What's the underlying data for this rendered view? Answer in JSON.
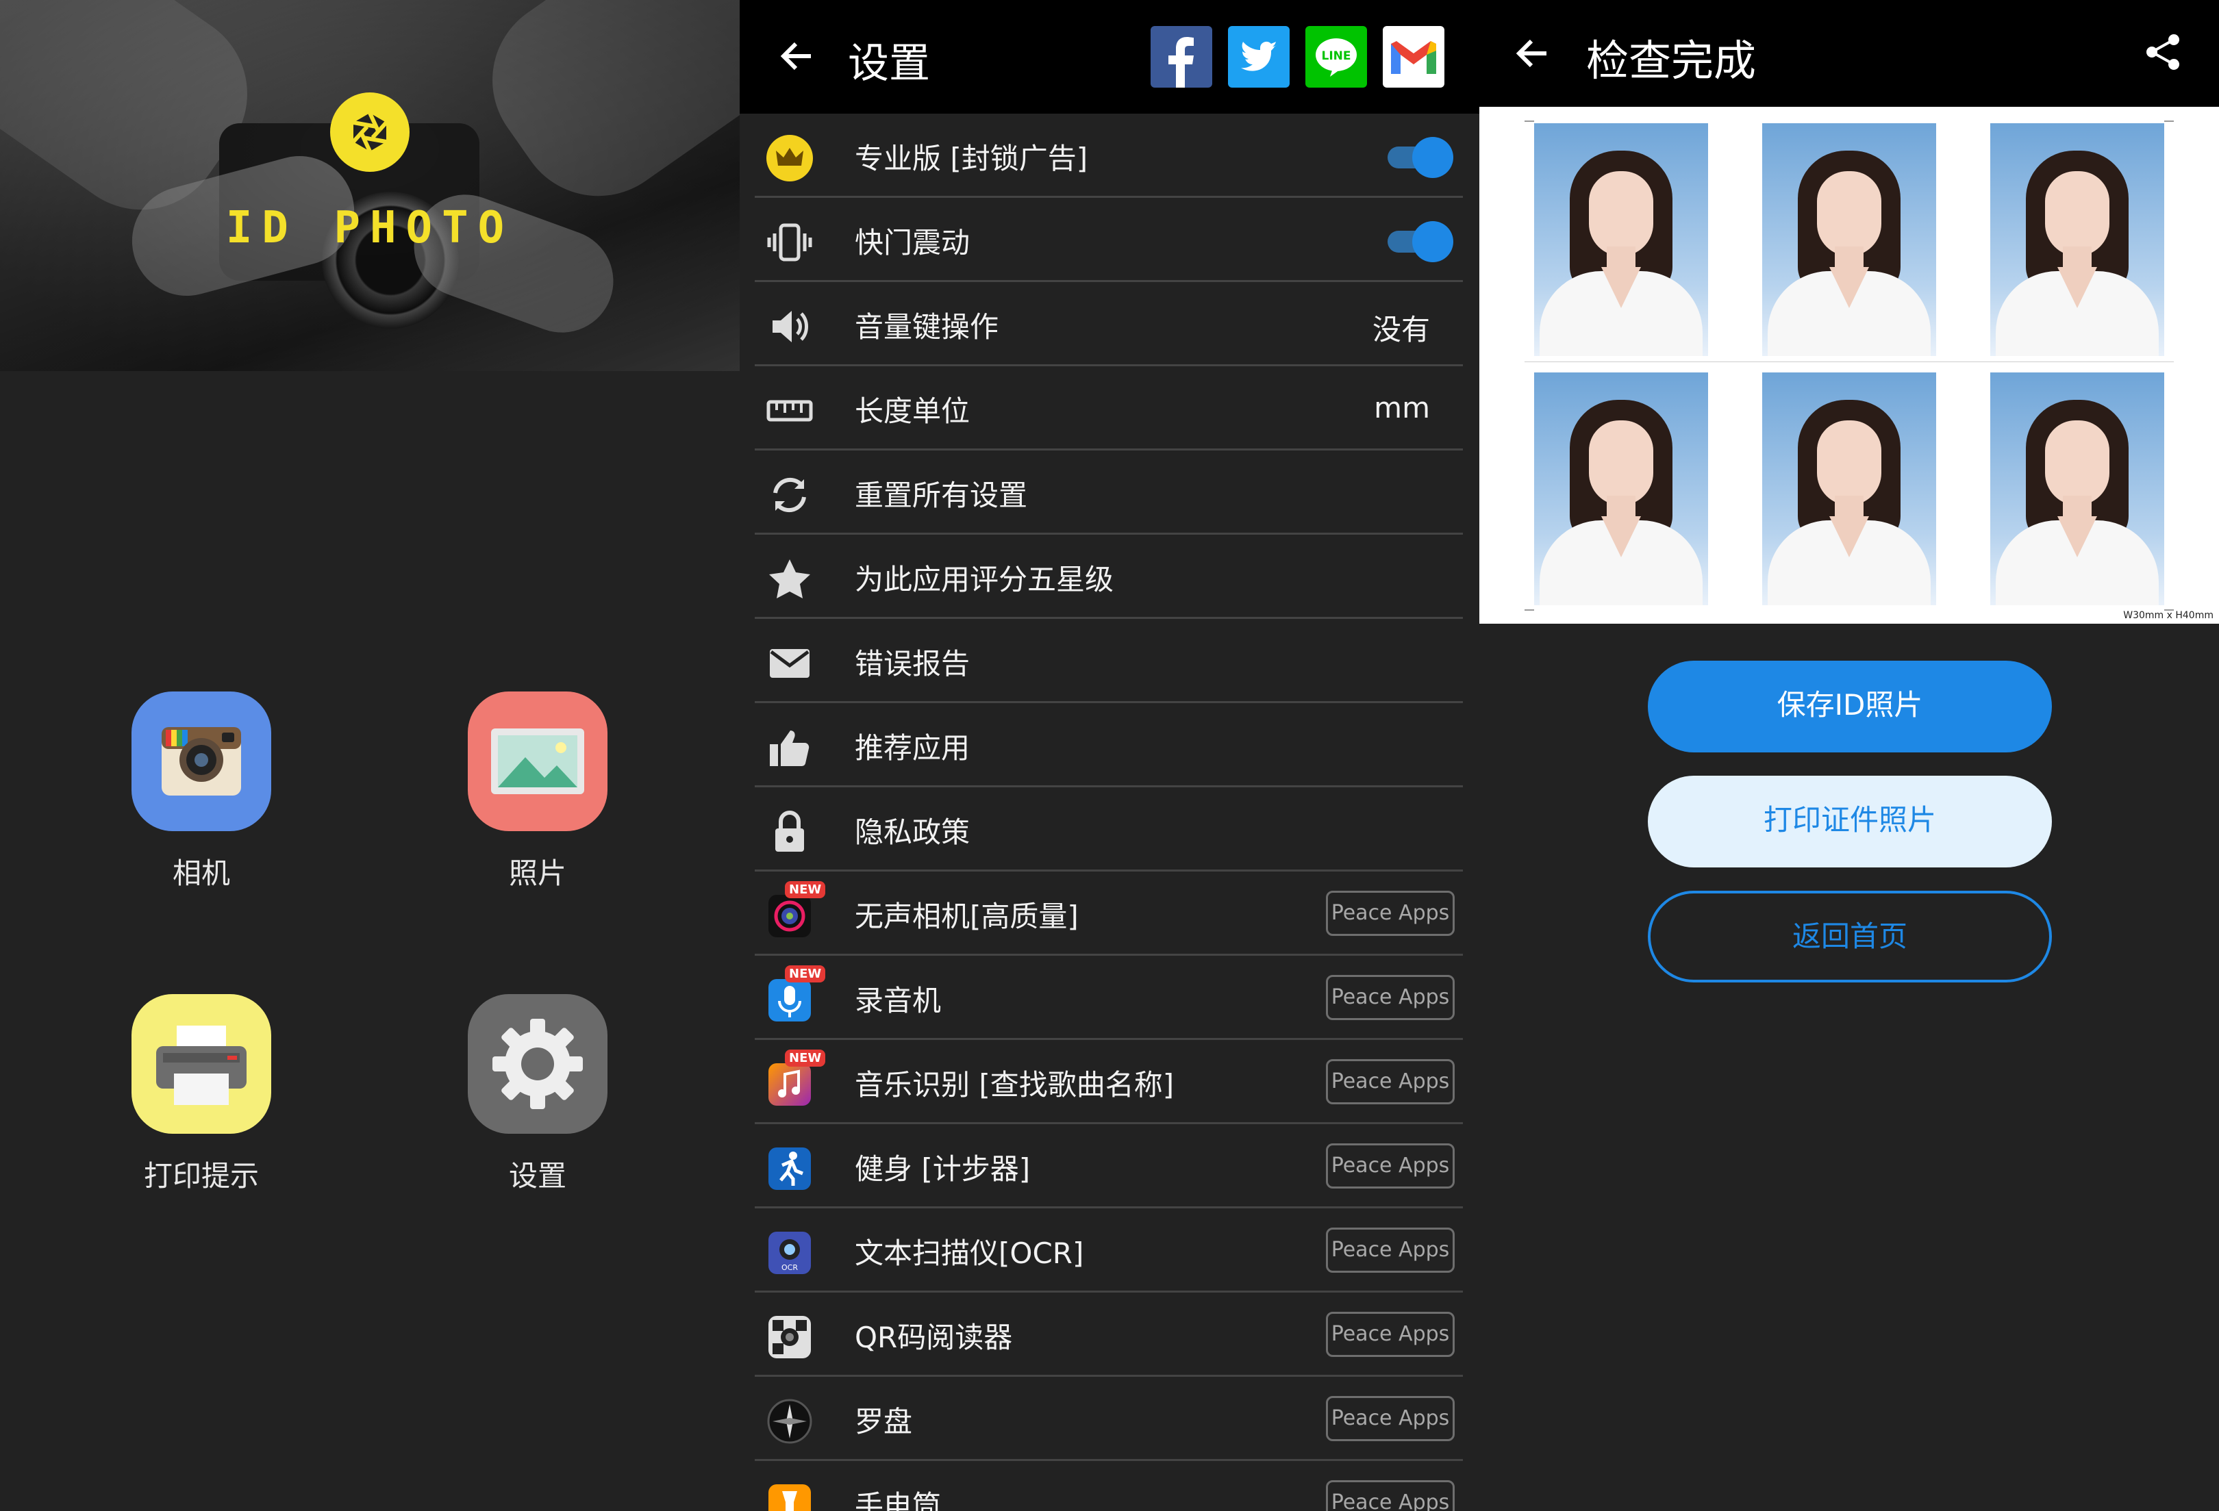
{
  "home": {
    "logo_text": "ID PHOTO",
    "tiles": [
      {
        "label": "相机",
        "icon": "camera-icon"
      },
      {
        "label": "照片",
        "icon": "photo-icon"
      },
      {
        "label": "打印提示",
        "icon": "printer-icon"
      },
      {
        "label": "设置",
        "icon": "gear-icon"
      }
    ]
  },
  "settings": {
    "title": "设置",
    "share_icons": [
      "facebook-icon",
      "twitter-icon",
      "line-icon",
      "gmail-icon"
    ],
    "items": [
      {
        "label": "专业版 [封锁广告]",
        "icon": "crown-icon",
        "toggle": true
      },
      {
        "label": "快门震动",
        "icon": "vibrate-icon",
        "toggle": true
      },
      {
        "label": "音量键操作",
        "icon": "volume-icon",
        "value": "没有"
      },
      {
        "label": "长度单位",
        "icon": "ruler-icon",
        "value": "mm"
      },
      {
        "label": "重置所有设置",
        "icon": "reset-icon"
      },
      {
        "label": "为此应用评分五星级",
        "icon": "star-icon"
      },
      {
        "label": "错误报告",
        "icon": "mail-icon"
      },
      {
        "label": "推荐应用",
        "icon": "thumbs-up-icon"
      },
      {
        "label": "隐私政策",
        "icon": "lock-icon"
      }
    ],
    "apps_new_badge": "NEW",
    "apps_chip": "Peace Apps",
    "apps": [
      {
        "label": "无声相机[高质量]",
        "icon": "silent-camera-icon",
        "new": true
      },
      {
        "label": "录音机",
        "icon": "recorder-icon",
        "new": true
      },
      {
        "label": "音乐识别 [查找歌曲名称]",
        "icon": "music-icon",
        "new": true
      },
      {
        "label": "健身 [计步器]",
        "icon": "fitness-icon",
        "new": false
      },
      {
        "label": "文本扫描仪[OCR]",
        "icon": "ocr-icon",
        "new": false
      },
      {
        "label": "QR码阅读器",
        "icon": "qr-icon",
        "new": false
      },
      {
        "label": "罗盘",
        "icon": "compass-icon",
        "new": false
      },
      {
        "label": "手电筒",
        "icon": "flashlight-icon",
        "new": false
      }
    ]
  },
  "result": {
    "title": "检查完成",
    "size_caption": "W30mm x H40mm",
    "buttons": {
      "save": "保存ID照片",
      "print": "打印证件照片",
      "home": "返回首页"
    }
  },
  "colors": {
    "accent": "#1e88e5",
    "logo_yellow": "#f4e02a",
    "background": "#222222"
  }
}
